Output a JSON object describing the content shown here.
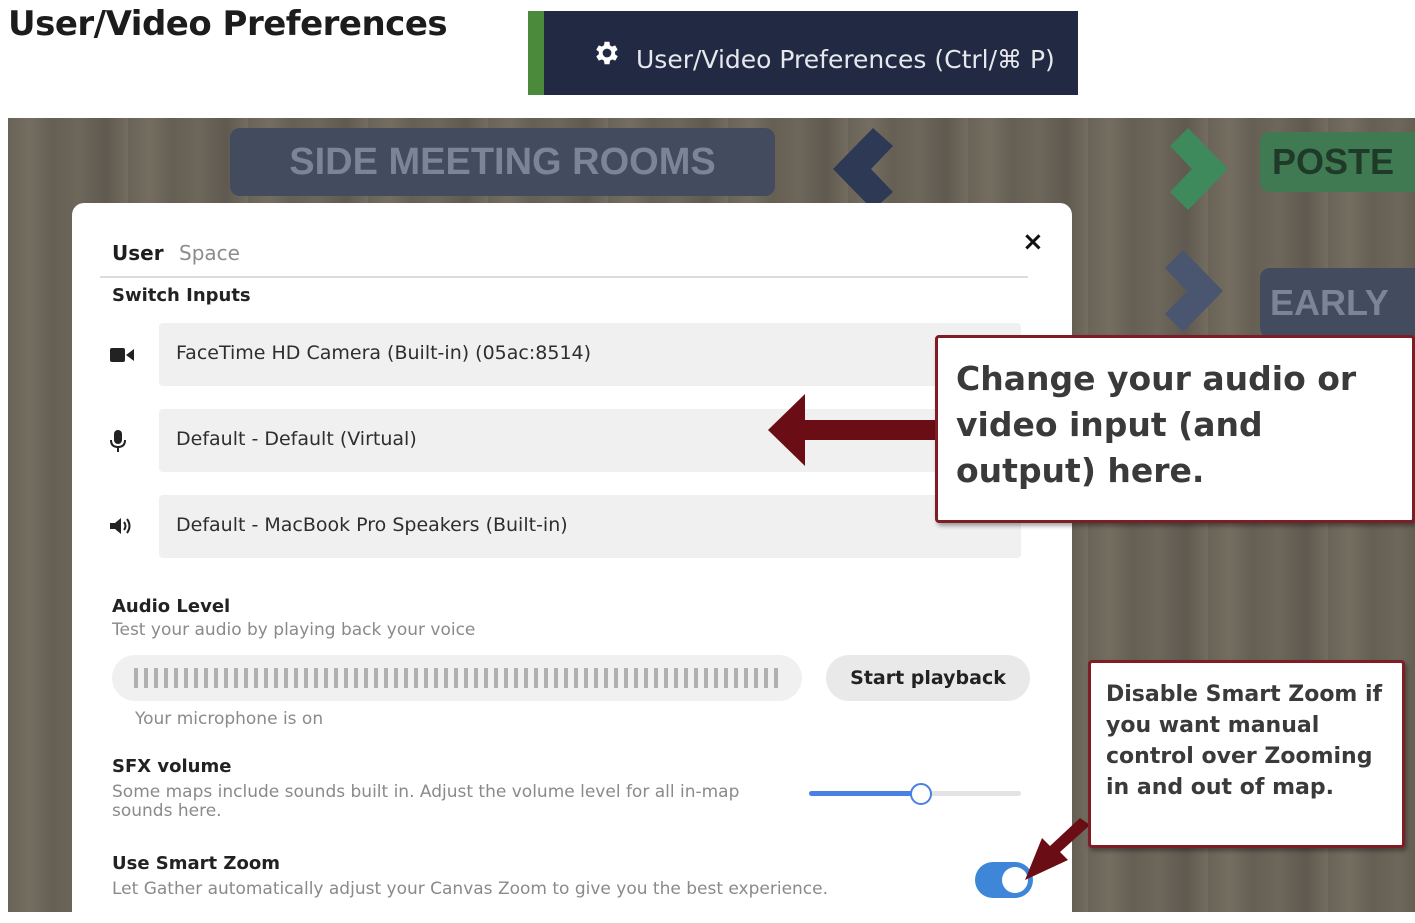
{
  "page": {
    "title": "User/Video Preferences"
  },
  "menu": {
    "label": "User/Video Preferences (Ctrl/⌘ P)",
    "icon": "gear-icon"
  },
  "map": {
    "sign_side_meeting": "SIDE MEETING ROOMS",
    "sign_poster": "POSTE",
    "sign_early": "EARLY"
  },
  "dialog": {
    "tabs": [
      {
        "label": "User",
        "active": true
      },
      {
        "label": "Space",
        "active": false
      }
    ],
    "close_label": "×",
    "switch_inputs": {
      "label": "Switch Inputs",
      "devices": [
        {
          "icon": "camera-icon",
          "value": "FaceTime HD Camera (Built-in) (05ac:8514)"
        },
        {
          "icon": "microphone-icon",
          "value": "Default - Default (Virtual)"
        },
        {
          "icon": "speaker-icon",
          "value": "Default - MacBook Pro Speakers (Built-in)"
        }
      ]
    },
    "audio_level": {
      "label": "Audio Level",
      "description": "Test your audio by playing back your voice",
      "button": "Start playback",
      "status": "Your microphone is on"
    },
    "sfx_volume": {
      "label": "SFX volume",
      "description": "Some maps include sounds built in. Adjust the volume level for all in-map sounds here.",
      "value_fraction": 0.53
    },
    "smart_zoom": {
      "label": "Use Smart Zoom",
      "description": "Let Gather automatically adjust your Canvas Zoom to give you the best experience.",
      "enabled": true
    }
  },
  "callouts": {
    "input": "Change your audio or video input (and output) here.",
    "zoom": "Disable Smart Zoom if you want manual control over Zooming in and out of map."
  },
  "colors": {
    "accent": "#3d86d8",
    "callout_border": "#7e1d26",
    "banner": "#222a43"
  }
}
